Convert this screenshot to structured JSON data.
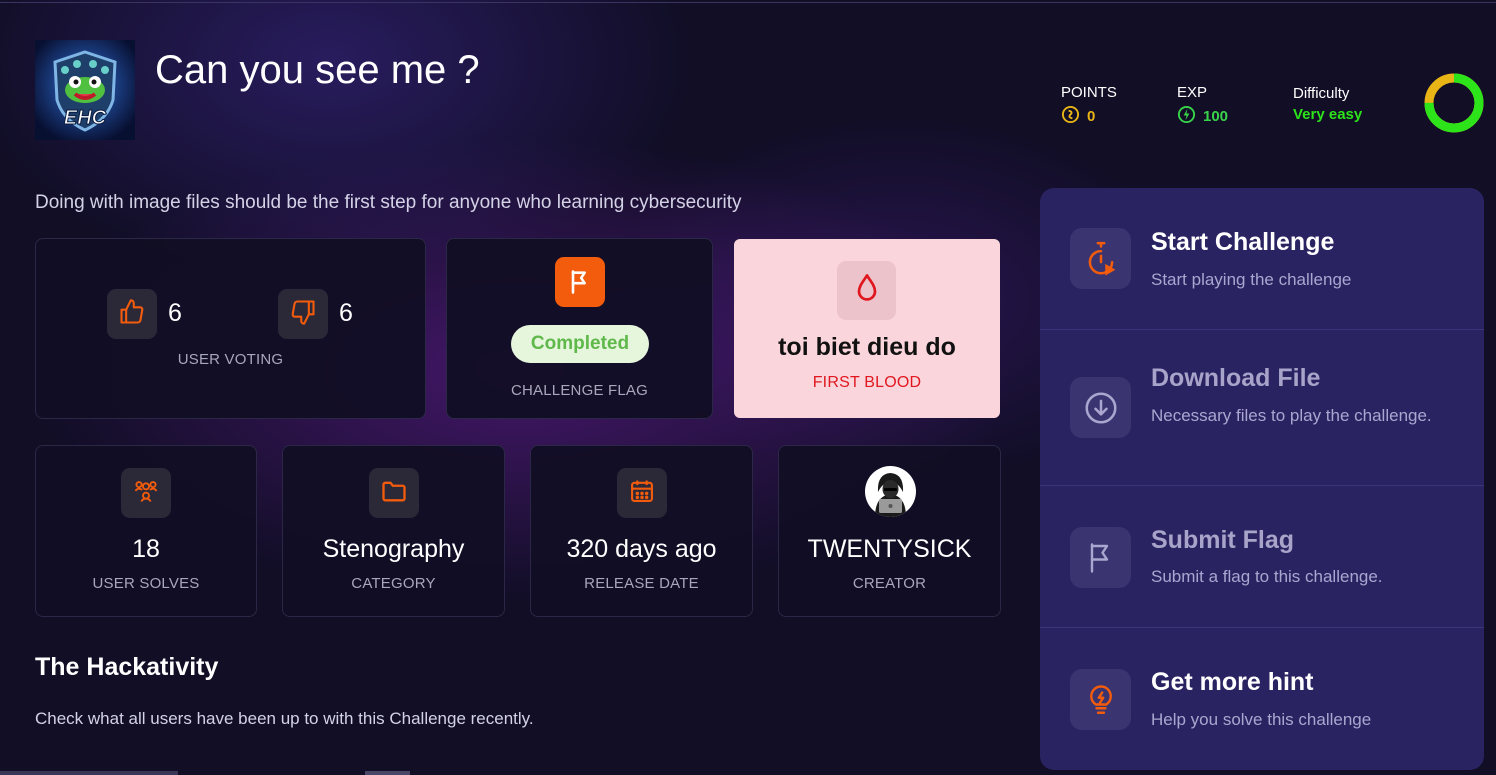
{
  "challenge": {
    "title": "Can you see me ?",
    "logo_text": "EHC",
    "description": "Doing with image files should be the first step for anyone who learning cybersecurity"
  },
  "stats": {
    "points_label": "POINTS",
    "points_value": "0",
    "exp_label": "EXP",
    "exp_value": "100",
    "difficulty_label": "Difficulty",
    "difficulty_value": "Very easy",
    "difficulty_ring_fraction": 0.75
  },
  "voting": {
    "likes": "6",
    "dislikes": "6",
    "label": "USER VOTING"
  },
  "flag_card": {
    "status": "Completed",
    "label": "CHALLENGE FLAG"
  },
  "first_blood": {
    "name": "toi biet dieu do",
    "label": "FIRST BLOOD"
  },
  "info_cards": {
    "solves": {
      "value": "18",
      "label": "USER SOLVES"
    },
    "category": {
      "value": "Stenography",
      "label": "CATEGORY"
    },
    "release": {
      "value": "320 days ago",
      "label": "RELEASE DATE"
    },
    "creator": {
      "value": "TWENTYSICK",
      "label": "CREATOR"
    }
  },
  "hackativity": {
    "title": "The Hackativity",
    "description": "Check what all users have been up to with this Challenge recently."
  },
  "actions": {
    "start": {
      "title": "Start Challenge",
      "subtitle": "Start playing the challenge"
    },
    "download": {
      "title": "Download File",
      "subtitle": "Necessary files to play the challenge."
    },
    "submit": {
      "title": "Submit Flag",
      "subtitle": "Submit a flag to this challenge."
    },
    "hint": {
      "title": "Get more hint",
      "subtitle": "Help you solve this challenge"
    }
  },
  "colors": {
    "accent_orange": "#f25c0c",
    "points_gold": "#e8b416",
    "exp_green": "#39d34a",
    "difficulty_green": "#2de31a",
    "panel_bg": "#2a2362",
    "first_blood_red": "#e0171f"
  },
  "icons": {
    "points": "coin-icon",
    "exp": "bolt-coin-icon",
    "like": "thumbs-up-icon",
    "dislike": "thumbs-down-icon",
    "flag": "flag-icon",
    "first_blood": "blood-drop-icon",
    "solves": "users-icon",
    "category": "folder-icon",
    "release": "calendar-icon",
    "start": "timer-play-icon",
    "download": "download-icon",
    "submit": "flag-outline-icon",
    "hint": "lightbulb-icon"
  }
}
